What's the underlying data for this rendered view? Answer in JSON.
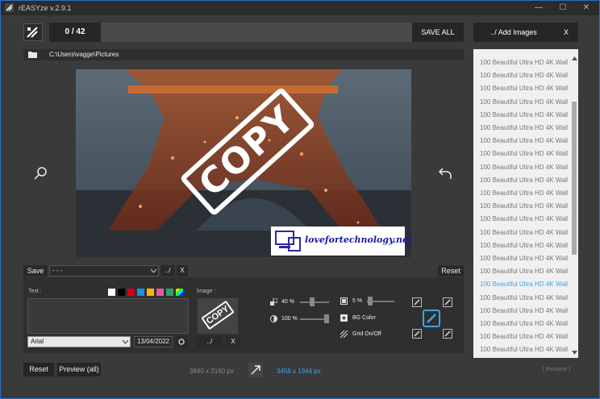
{
  "window": {
    "title": "rEASYze v.2.9.1",
    "minimize": "—",
    "maximize": "☐",
    "close": "✕"
  },
  "toolbar": {
    "counter": "0 / 42",
    "save_all": "SAVE ALL",
    "add_images": "../ Add Images",
    "add_close": "X"
  },
  "path": {
    "folder": "C:\\Users\\vagge\\Pictures"
  },
  "preview": {
    "watermark_text": "COPY",
    "logo_text": "lovefortechnology.net"
  },
  "save_row": {
    "save_label": "Save",
    "dropdown_value": "- - -",
    "browse": "../",
    "clear": "X",
    "reset": "Reset"
  },
  "text_panel": {
    "label": "Text :",
    "font": "Arial",
    "date": "13/04/2022",
    "colors": [
      "#ffffff",
      "#000000",
      "#d0021b",
      "#1e90e0",
      "#f5b800",
      "#e05aa0",
      "#2e9e6e"
    ]
  },
  "image_panel": {
    "label": "Image :",
    "browse": "../",
    "clear": "X",
    "thumb_text": "COPY"
  },
  "settings": {
    "size_value": "40 %",
    "opacity_value": "100 %",
    "margin_value": "5 %",
    "size_level": 0.4,
    "opacity_level": 1.0,
    "margin_level": 0.05,
    "bg_color": "BG Color",
    "grid": "Grid On/Off"
  },
  "footer": {
    "reset": "Reset",
    "preview_all": "Preview (all)",
    "original_size": "3840 x 2160 px",
    "new_size": "3456 x 1944 px",
    "rename": "[ Rename ]"
  },
  "file_list": {
    "selected_index": 17,
    "items": [
      "100 Beautiful Ultra HD 4K Wall",
      "100 Beautiful Ultra HD 4K Wall",
      "100 Beautiful Ultra HD 4K Wall",
      "100 Beautiful Ultra HD 4K Wall",
      "100 Beautiful Ultra HD 4K Wall",
      "100 Beautiful Ultra HD 4K Wall",
      "100 Beautiful Ultra HD 4K Wall",
      "100 Beautiful Ultra HD 4K Wall",
      "100 Beautiful Ultra HD 4K Wall",
      "100 Beautiful Ultra HD 4K Wall",
      "100 Beautiful Ultra HD 4K Wall",
      "100 Beautiful Ultra HD 4K Wall",
      "100 Beautiful Ultra HD 4K Wall",
      "100 Beautiful Ultra HD 4K Wall",
      "100 Beautiful Ultra HD 4K Wall",
      "100 Beautiful Ultra HD 4K Wall",
      "100 Beautiful Ultra HD 4K Wall",
      "100 Beautiful Ultra HD 4K Wall",
      "100 Beautiful Ultra HD 4K Wall",
      "100 Beautiful Ultra HD 4K Wall",
      "100 Beautiful Ultra HD 4K Wall",
      "100 Beautiful Ultra HD 4K Wall",
      "100 Beautiful Ultra HD 4K Wall"
    ]
  }
}
